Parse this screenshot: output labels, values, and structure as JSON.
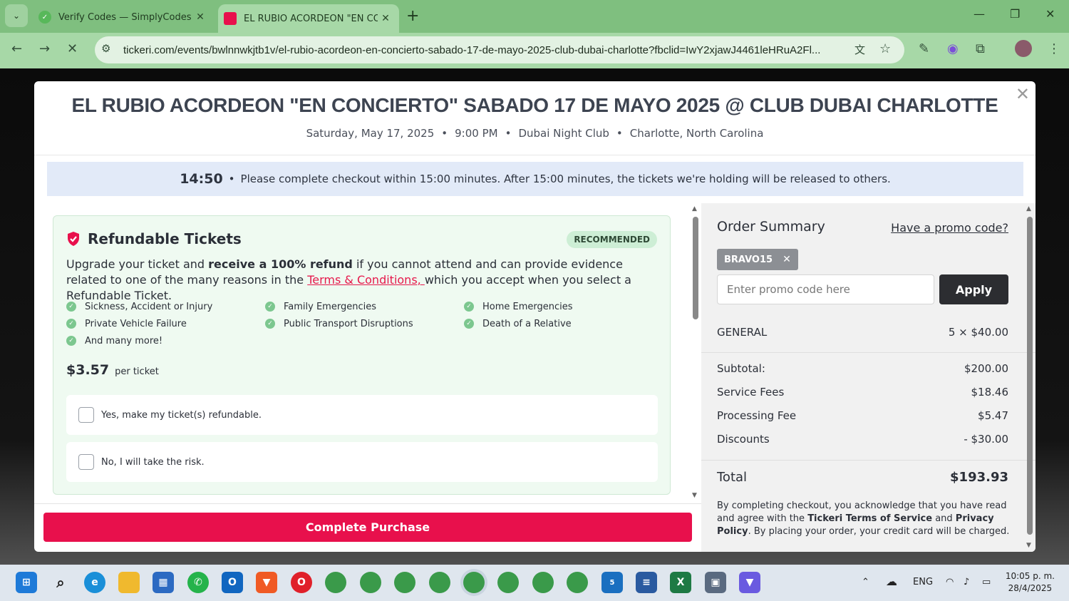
{
  "browser": {
    "tabs": [
      {
        "title": "Verify Codes — SimplyCodes",
        "active": false
      },
      {
        "title": "EL RUBIO ACORDEON \"EN CON",
        "active": true
      }
    ],
    "url": "tickeri.com/events/bwlnnwkjtb1v/el-rubio-acordeon-en-concierto-sabado-17-de-mayo-2025-club-dubai-charlotte?fbclid=IwY2xjawJ4461leHRuA2Fl..."
  },
  "event": {
    "title": "EL RUBIO ACORDEON \"EN CONCIERTO\" SABADO 17 DE MAYO 2025 @ CLUB DUBAI CHARLOTTE",
    "date": "Saturday, May 17, 2025",
    "time": "9:00 PM",
    "venue": "Dubai Night Club",
    "location": "Charlotte, North Carolina",
    "separator": "•"
  },
  "timer": {
    "remaining": "14:50",
    "separator": "•",
    "message": "Please complete checkout within 15:00 minutes. After 15:00 minutes, the tickets we're holding will be released to others."
  },
  "refundable": {
    "title": "Refundable Tickets",
    "badge": "RECOMMENDED",
    "desc_1": "Upgrade your ticket and ",
    "desc_bold": "receive a 100% refund",
    "desc_2": " if you cannot attend and can provide evidence related to one of the many reasons in the ",
    "desc_link": "Terms & Conditions, ",
    "desc_3": "which you accept when you select a Refundable Ticket.",
    "reasons": [
      "Sickness, Accident or Injury",
      "Family Emergencies",
      "Home Emergencies",
      "Private Vehicle Failure",
      "Public Transport Disruptions",
      "Death of a Relative",
      "And many more!"
    ],
    "price": "$3.57",
    "price_unit": "per ticket",
    "option_yes": "Yes, make my ticket(s) refundable.",
    "option_no": "No, I will take the risk."
  },
  "summary": {
    "title": "Order Summary",
    "promo_link": "Have a promo code?",
    "applied_code": "BRAVO15",
    "promo_placeholder": "Enter promo code here",
    "apply_label": "Apply",
    "ticket_type": "GENERAL",
    "ticket_qty_price": "5 × $40.00",
    "subtotal_label": "Subtotal:",
    "subtotal": "$200.00",
    "service_label": "Service Fees",
    "service": "$18.46",
    "processing_label": "Processing Fee",
    "processing": "$5.47",
    "discount_label": "Discounts",
    "discount": "- $30.00",
    "total_label": "Total",
    "total": "$193.93",
    "legal_1": "By completing checkout, you acknowledge that you have read and agree with the ",
    "legal_tos": "Tickeri Terms of Service",
    "legal_2": " and ",
    "legal_privacy": "Privacy Policy",
    "legal_3": ". By placing your order, your credit card will be charged."
  },
  "complete_label": "Complete Purchase",
  "taskbar": {
    "language": "ENG",
    "time": "10:05 p. m.",
    "date": "28/4/2025",
    "badge_count": "5"
  },
  "colors": {
    "accent": "#e8104c",
    "chrome": "#7fbf7f",
    "refund_bg": "#effaf1"
  }
}
